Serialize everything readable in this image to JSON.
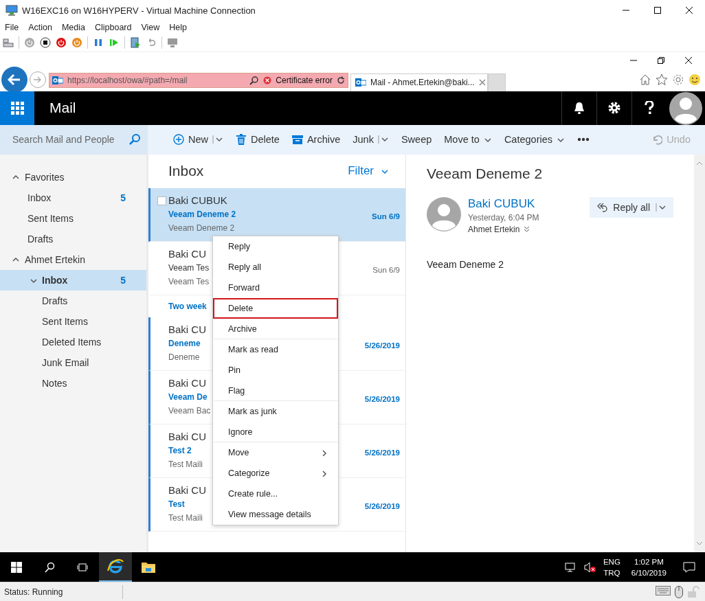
{
  "vm_window": {
    "title": "W16EXC16 on W16HYPERV - Virtual Machine Connection",
    "menu": [
      "File",
      "Action",
      "Media",
      "Clipboard",
      "View",
      "Help"
    ],
    "status": "Status: Running"
  },
  "browser": {
    "url": "https://localhost/owa/#path=/mail",
    "certificate_error": "Certificate error",
    "tabs": [
      {
        "title": "Mail - Ahmet.Ertekin@baki...",
        "selected": true
      }
    ]
  },
  "app_header": {
    "title": "Mail"
  },
  "search": {
    "placeholder": "Search Mail and People"
  },
  "commands": [
    {
      "label": "New",
      "kind": "new",
      "split": true,
      "disabled": false
    },
    {
      "label": "Delete",
      "kind": "delete",
      "split": false,
      "disabled": false
    },
    {
      "label": "Archive",
      "kind": "archive",
      "split": false,
      "disabled": false
    },
    {
      "label": "Junk",
      "kind": "plain",
      "split": true,
      "disabled": false
    },
    {
      "label": "Sweep",
      "kind": "plain",
      "split": false,
      "disabled": false
    },
    {
      "label": "Move to",
      "kind": "menu",
      "split": false,
      "disabled": false
    },
    {
      "label": "Categories",
      "kind": "menu",
      "split": false,
      "disabled": false
    },
    {
      "kind": "more",
      "split": false,
      "disabled": false
    },
    {
      "label": "Undo",
      "kind": "undo",
      "split": false,
      "disabled": true
    }
  ],
  "nav": {
    "groups": [
      {
        "label": "Favorites",
        "expanded": true,
        "children": [
          {
            "label": "Inbox",
            "count": "5",
            "selected": false
          },
          {
            "label": "Sent Items",
            "selected": false
          },
          {
            "label": "Drafts",
            "selected": false
          }
        ]
      },
      {
        "label": "Ahmet Ertekin",
        "expanded": true,
        "children": [
          {
            "label": "Inbox",
            "count": "5",
            "selected": true,
            "expanded": true
          },
          {
            "label": "Drafts",
            "selected": false
          },
          {
            "label": "Sent Items",
            "selected": false
          },
          {
            "label": "Deleted Items",
            "selected": false
          },
          {
            "label": "Junk Email",
            "selected": false
          },
          {
            "label": "Notes",
            "selected": false
          }
        ]
      }
    ]
  },
  "message_list": {
    "title": "Inbox",
    "filter": "Filter",
    "items": [
      {
        "kind": "message",
        "sender": "Baki CUBUK",
        "subject": "Veeam Deneme 2",
        "preview": "Veeam Deneme 2",
        "date": "Sun 6/9",
        "unread": true,
        "selected": true
      },
      {
        "kind": "message",
        "sender": "Baki CU",
        "subject": "Veeam Tes",
        "preview": "Veeam Tes",
        "date": "Sun 6/9",
        "unread": false,
        "selected": false
      },
      {
        "kind": "group",
        "label": "Two week"
      },
      {
        "kind": "message",
        "sender": "Baki CU",
        "subject": "Deneme",
        "preview": "Deneme",
        "date": "5/26/2019",
        "unread": true,
        "selected": false
      },
      {
        "kind": "message",
        "sender": "Baki CU",
        "subject": "Veeam De",
        "preview": "Veeam Bac",
        "date": "5/26/2019",
        "unread": true,
        "selected": false
      },
      {
        "kind": "message",
        "sender": "Baki CU",
        "subject": "Test 2",
        "preview": "Test Maili",
        "date": "5/26/2019",
        "unread": true,
        "selected": false
      },
      {
        "kind": "message",
        "sender": "Baki CU",
        "subject": "Test",
        "preview": "Test Maili",
        "date": "5/26/2019",
        "unread": true,
        "selected": false
      }
    ]
  },
  "context_menu": {
    "items": [
      {
        "label": "Reply",
        "highlighted": false,
        "submenu": false,
        "separator_after": false
      },
      {
        "label": "Reply all",
        "highlighted": false,
        "submenu": false,
        "separator_after": false
      },
      {
        "label": "Forward",
        "highlighted": false,
        "submenu": false,
        "separator_after": false
      },
      {
        "label": "Delete",
        "highlighted": true,
        "submenu": false,
        "separator_after": false
      },
      {
        "label": "Archive",
        "highlighted": false,
        "submenu": false,
        "separator_after": true
      },
      {
        "label": "Mark as read",
        "highlighted": false,
        "submenu": false,
        "separator_after": false
      },
      {
        "label": "Pin",
        "highlighted": false,
        "submenu": false,
        "separator_after": false
      },
      {
        "label": "Flag",
        "highlighted": false,
        "submenu": false,
        "separator_after": true
      },
      {
        "label": "Mark as junk",
        "highlighted": false,
        "submenu": false,
        "separator_after": false
      },
      {
        "label": "Ignore",
        "highlighted": false,
        "submenu": false,
        "separator_after": true
      },
      {
        "label": "Move",
        "highlighted": false,
        "submenu": true,
        "separator_after": false
      },
      {
        "label": "Categorize",
        "highlighted": false,
        "submenu": true,
        "separator_after": false
      },
      {
        "label": "Create rule...",
        "highlighted": false,
        "submenu": false,
        "separator_after": false
      },
      {
        "label": "View message details",
        "highlighted": false,
        "submenu": false,
        "separator_after": false
      }
    ]
  },
  "reading_pane": {
    "subject": "Veeam Deneme 2",
    "sender": "Baki CUBUK",
    "time": "Yesterday, 6:04 PM",
    "recipient": "Ahmet Ertekin",
    "reply_button": "Reply all",
    "body": "Veeam Deneme 2"
  },
  "taskbar": {
    "apps": [
      {
        "kind": "browser",
        "selected": true
      },
      {
        "kind": "folder",
        "selected": false
      }
    ],
    "language": [
      "ENG",
      "TRQ"
    ],
    "time": "1:02 PM",
    "date": "6/10/2019",
    "volume_muted": true
  }
}
